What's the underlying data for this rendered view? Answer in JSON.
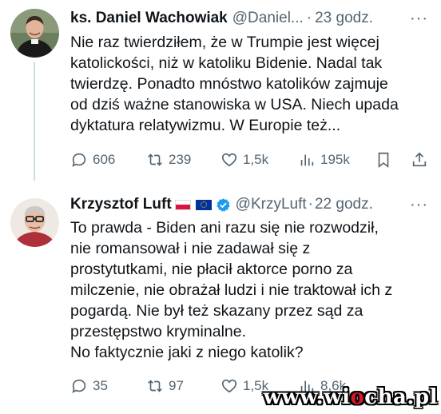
{
  "tweets": [
    {
      "author_name": "ks. Daniel Wachowiak",
      "handle": "@Daniel...",
      "separator": "·",
      "time": "23 godz.",
      "more": "···",
      "text": "Nie raz twierdziłem, że w Trumpie jest więcej\nkatolickości, niż w katoliku Bidenie. Nadal tak\ntwierdzę. Ponadto mnóstwo katolików zajmuje\nod dziś ważne stanowiska w USA. Niech upada\ndyktatura relatywizmu. W Europie też...",
      "replies": "606",
      "reposts": "239",
      "likes": "1,5k",
      "views": "195k"
    },
    {
      "author_name": "Krzysztof Luft",
      "handle": "@KrzyLuft",
      "separator": "·",
      "time": "22 godz.",
      "more": "···",
      "text": "To prawda - Biden ani razu się nie rozwodził,\nnie romansował i nie zadawał się z\nprostytutkami, nie płacił aktorce porno za\nmilczenie, nie obrażał ludzi i nie traktował ich z\npogardą. Nie był też skazany przez sąd za\nprzestępstwo kryminalne.\nNo faktycznie jaki z niego katolik?",
      "replies": "35",
      "reposts": "97",
      "likes": "1,5k",
      "views": "8,6k"
    }
  ],
  "watermark": {
    "prefix": "www.wi",
    "accent": "o",
    "suffix": "cha.pl"
  },
  "colors": {
    "text": "#0f1419",
    "secondary": "#536471",
    "verified": "#1d9bf0",
    "thread_line": "#cfd9de"
  }
}
